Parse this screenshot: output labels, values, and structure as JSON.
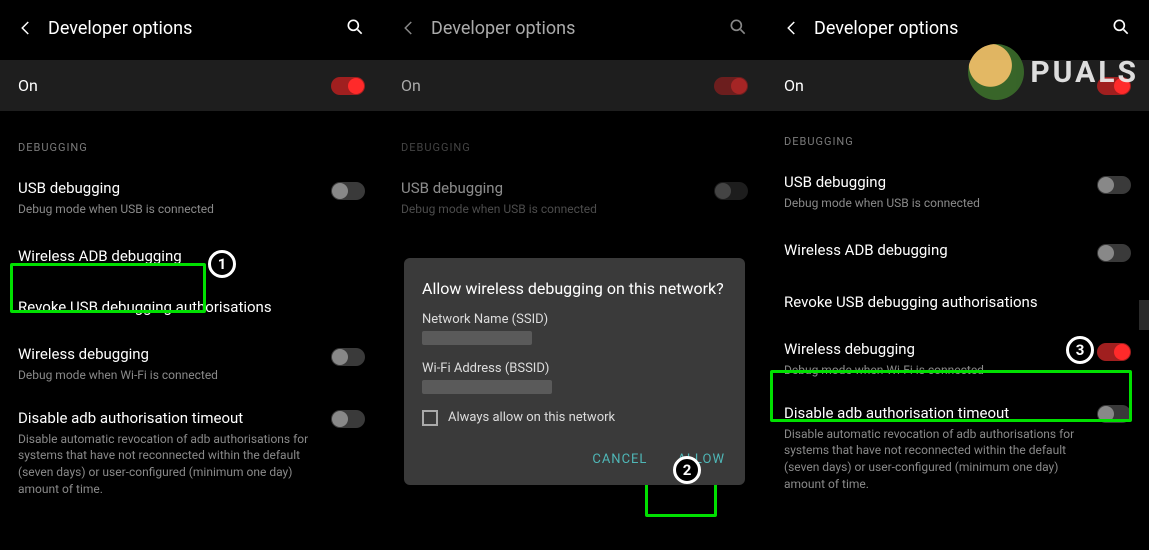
{
  "header": {
    "title": "Developer options"
  },
  "on_row": {
    "label": "On"
  },
  "section_debugging": "DEBUGGING",
  "items": {
    "usb": {
      "label": "USB debugging",
      "sub": "Debug mode when USB is connected"
    },
    "wireless_adb": {
      "label": "Wireless ADB debugging"
    },
    "revoke": {
      "label": "Revoke USB debugging authorisations"
    },
    "wireless_dbg": {
      "label": "Wireless debugging",
      "sub": "Debug mode when Wi-Fi is connected"
    },
    "disable_timeout": {
      "label": "Disable adb authorisation timeout",
      "sub": "Disable automatic revocation of adb authorisations for systems that have not reconnected within the default (seven days) or user-configured (minimum one day) amount of time."
    }
  },
  "dialog": {
    "title": "Allow wireless debugging on this network?",
    "ssid_label": "Network Name (SSID)",
    "bssid_label": "Wi-Fi Address (BSSID)",
    "always_label": "Always allow on this network",
    "cancel": "CANCEL",
    "allow": "ALLOW"
  },
  "badges": {
    "one": "1",
    "two": "2",
    "three": "3"
  },
  "watermark": {
    "text": "PUALS"
  }
}
